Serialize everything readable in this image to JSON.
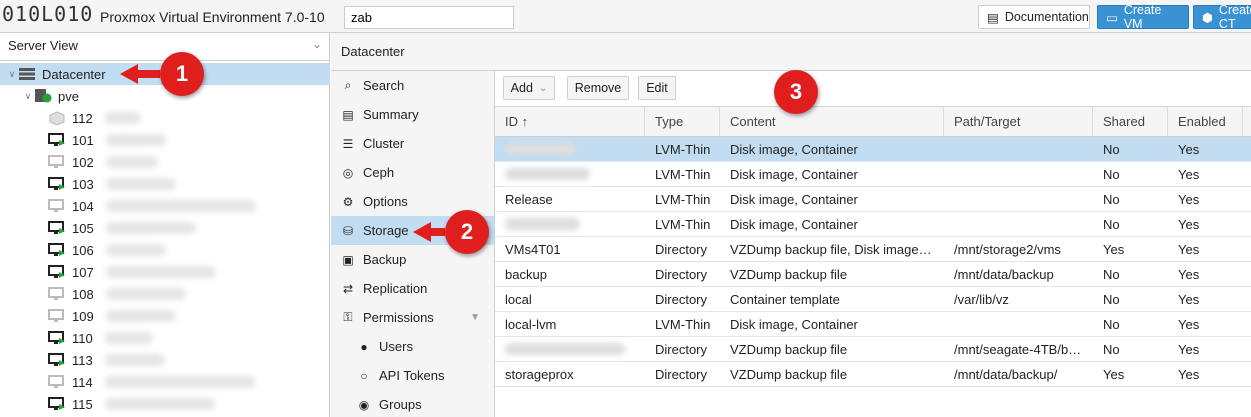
{
  "topbar": {
    "logo_text": "010L010",
    "app_title": "Proxmox Virtual Environment 7.0-10",
    "search_value": "zab",
    "documentation_label": "Documentation",
    "create_vm_label": "Create VM",
    "create_ct_label": "Create CT"
  },
  "left": {
    "view_label": "Server View",
    "tree": [
      {
        "label": "Datacenter",
        "kind": "datacenter"
      },
      {
        "label": "pve",
        "kind": "node"
      },
      {
        "label": "112",
        "kind": "template"
      },
      {
        "label": "101",
        "kind": "vm-running"
      },
      {
        "label": "102",
        "kind": "vm-stopped"
      },
      {
        "label": "103",
        "kind": "vm-running"
      },
      {
        "label": "104",
        "kind": "vm-stopped"
      },
      {
        "label": "105",
        "kind": "vm-running"
      },
      {
        "label": "106",
        "kind": "vm-running"
      },
      {
        "label": "107",
        "kind": "vm-running"
      },
      {
        "label": "108",
        "kind": "vm-stopped"
      },
      {
        "label": "109",
        "kind": "vm-stopped"
      },
      {
        "label": "110",
        "kind": "vm-running"
      },
      {
        "label": "113",
        "kind": "vm-running"
      },
      {
        "label": "114",
        "kind": "vm-stopped"
      },
      {
        "label": "115",
        "kind": "vm-running"
      }
    ]
  },
  "middle": {
    "header": "Datacenter",
    "nav": [
      {
        "label": "Search",
        "icon": "search-icon",
        "glyph": "⌕"
      },
      {
        "label": "Summary",
        "icon": "book-icon",
        "glyph": "▤"
      },
      {
        "label": "Cluster",
        "icon": "server-icon",
        "glyph": "☰"
      },
      {
        "label": "Ceph",
        "icon": "ceph-icon",
        "glyph": "◎"
      },
      {
        "label": "Options",
        "icon": "gear-icon",
        "glyph": "⚙"
      },
      {
        "label": "Storage",
        "icon": "database-icon",
        "glyph": "⛁"
      },
      {
        "label": "Backup",
        "icon": "floppy-icon",
        "glyph": "▣"
      },
      {
        "label": "Replication",
        "icon": "retweet-icon",
        "glyph": "⇄"
      },
      {
        "label": "Permissions",
        "icon": "unlock-icon",
        "glyph": "⚿"
      },
      {
        "label": "Users",
        "icon": "user-icon",
        "glyph": "●"
      },
      {
        "label": "API Tokens",
        "icon": "user-outline-icon",
        "glyph": "○"
      },
      {
        "label": "Groups",
        "icon": "users-icon",
        "glyph": "◉"
      }
    ]
  },
  "toolbar": {
    "add_label": "Add",
    "remove_label": "Remove",
    "edit_label": "Edit"
  },
  "table": {
    "headers": [
      "ID ↑",
      "Type",
      "Content",
      "Path/Target",
      "Shared",
      "Enabled"
    ],
    "rows": [
      {
        "id": "",
        "type": "LVM-Thin",
        "content": "Disk image, Container",
        "path": "",
        "shared": "No",
        "enabled": "Yes"
      },
      {
        "id": "",
        "type": "LVM-Thin",
        "content": "Disk image, Container",
        "path": "",
        "shared": "No",
        "enabled": "Yes"
      },
      {
        "id": "Release",
        "type": "LVM-Thin",
        "content": "Disk image, Container",
        "path": "",
        "shared": "No",
        "enabled": "Yes"
      },
      {
        "id": "",
        "type": "LVM-Thin",
        "content": "Disk image, Container",
        "path": "",
        "shared": "No",
        "enabled": "Yes"
      },
      {
        "id": "VMs4T01",
        "type": "Directory",
        "content": "VZDump backup file, Disk image…",
        "path": "/mnt/storage2/vms",
        "shared": "Yes",
        "enabled": "Yes"
      },
      {
        "id": "backup",
        "type": "Directory",
        "content": "VZDump backup file",
        "path": "/mnt/data/backup",
        "shared": "No",
        "enabled": "Yes"
      },
      {
        "id": "local",
        "type": "Directory",
        "content": "Container template",
        "path": "/var/lib/vz",
        "shared": "No",
        "enabled": "Yes"
      },
      {
        "id": "local-lvm",
        "type": "LVM-Thin",
        "content": "Disk image, Container",
        "path": "",
        "shared": "No",
        "enabled": "Yes"
      },
      {
        "id": "",
        "type": "Directory",
        "content": "VZDump backup file",
        "path": "/mnt/seagate-4TB/b…",
        "shared": "No",
        "enabled": "Yes"
      },
      {
        "id": "storageprox",
        "type": "Directory",
        "content": "VZDump backup file",
        "path": "/mnt/data/backup/",
        "shared": "Yes",
        "enabled": "Yes"
      }
    ]
  },
  "annotations": {
    "badge1": "1",
    "badge2": "2",
    "badge3": "3"
  },
  "colors": {
    "selection": "#c2ddf2",
    "accent": "#3892d4",
    "annotation_red": "#e01e1e",
    "status_green": "#21a633"
  }
}
